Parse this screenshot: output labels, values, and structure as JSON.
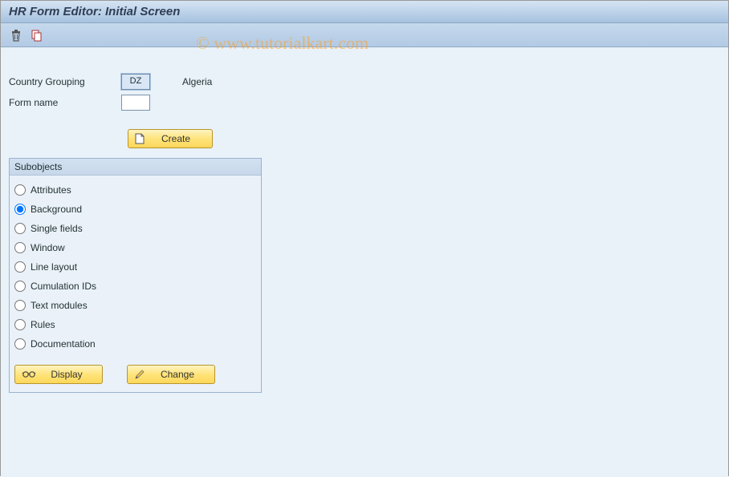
{
  "title": "HR Form Editor: Initial Screen",
  "watermark": "© www.tutorialkart.com",
  "fields": {
    "country_grouping_label": "Country Grouping",
    "country_grouping_value": "DZ",
    "country_grouping_desc": "Algeria",
    "form_name_label": "Form name",
    "form_name_value": ""
  },
  "buttons": {
    "create": "Create",
    "display": "Display",
    "change": "Change"
  },
  "subobjects": {
    "title": "Subobjects",
    "selected": "Background",
    "items": [
      "Attributes",
      "Background",
      "Single fields",
      "Window",
      "Line layout",
      "Cumulation IDs",
      "Text modules",
      "Rules",
      "Documentation"
    ]
  }
}
